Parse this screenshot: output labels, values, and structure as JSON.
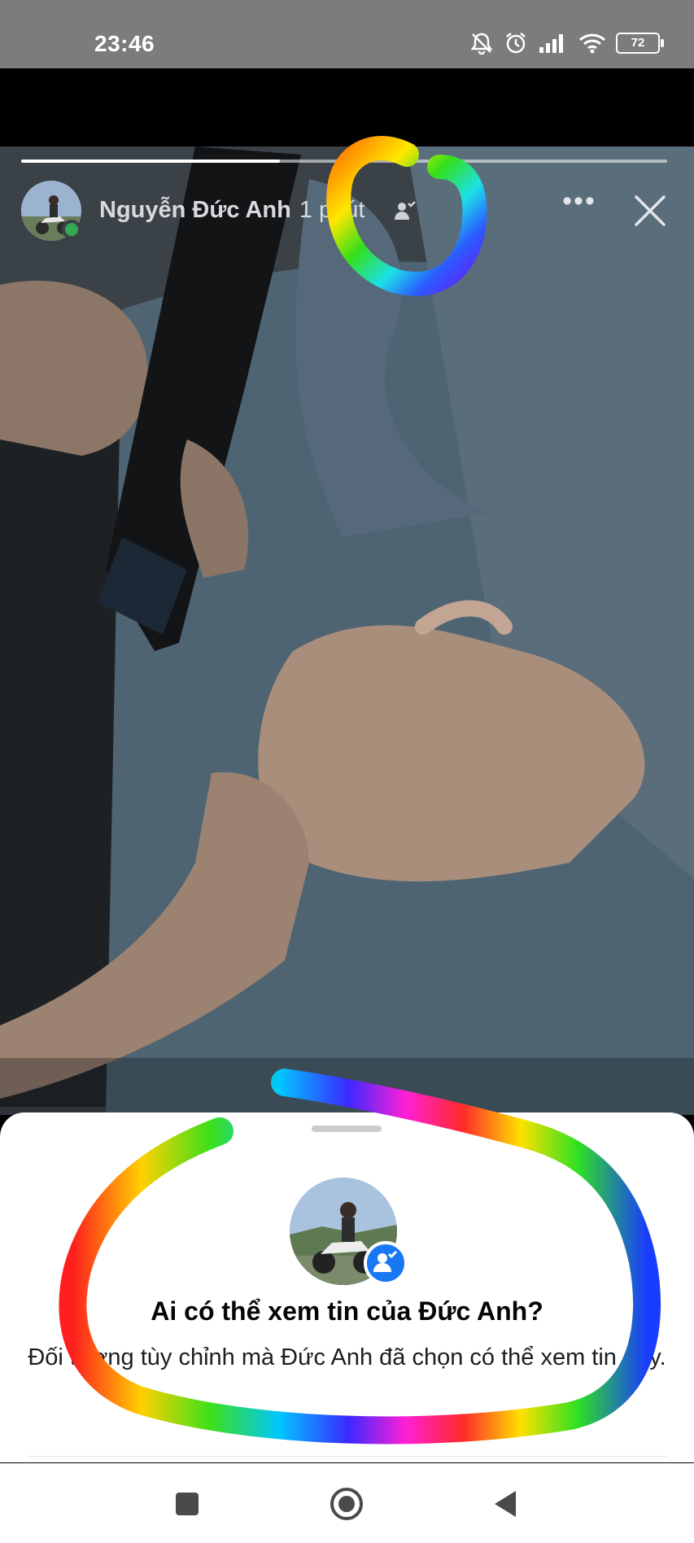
{
  "status_bar": {
    "time": "23:46",
    "icons": [
      "bell-off-icon",
      "alarm-icon",
      "signal-icon",
      "wifi-icon"
    ],
    "battery": "72"
  },
  "story": {
    "poster_name": "Nguyễn Đức Anh",
    "age": "1 phút",
    "audience_icon": "friends-custom-icon",
    "more_label": "•••",
    "close_icon": "close-icon"
  },
  "sheet": {
    "title": "Ai có thể xem tin của Đức Anh?",
    "description": "Đối tượng tùy chỉnh mà Đức Anh đã chọn có thể xem tin này.",
    "badge_icon": "friends-custom-icon"
  },
  "nav": {
    "buttons": [
      "recents-square-icon",
      "home-circle-icon",
      "back-triangle-icon"
    ]
  },
  "colors": {
    "sheet_badge": "#1877f2",
    "online_dot": "#35a853",
    "status_bar": "#7c7c7c"
  }
}
